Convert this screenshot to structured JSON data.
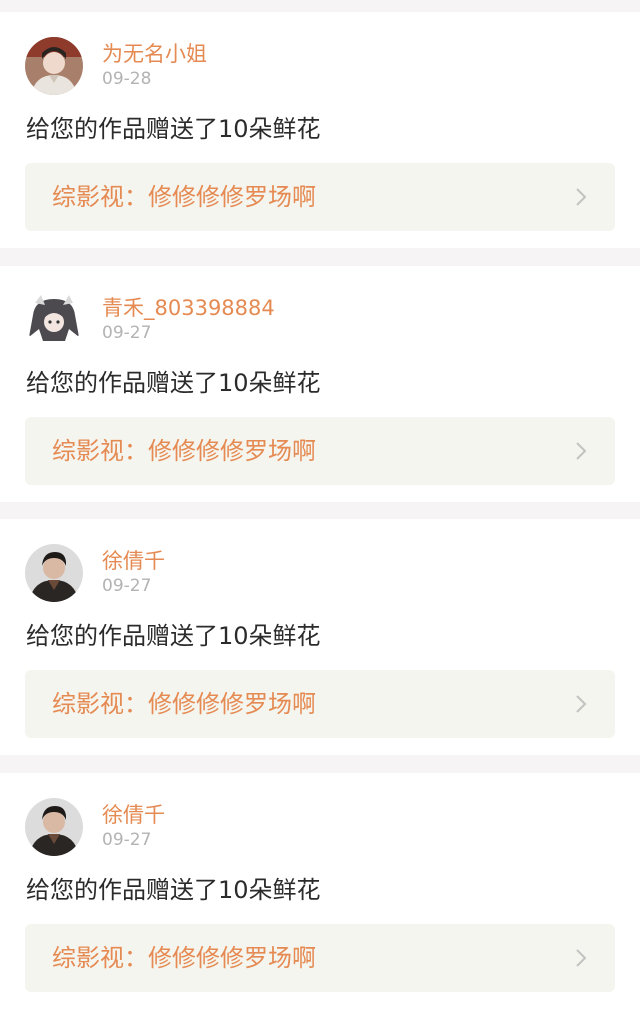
{
  "notifications": [
    {
      "username": "为无名小姐",
      "date": "09-28",
      "message": "给您的作品赠送了10朵鲜花",
      "work_label": "综影视：修修修修罗场啊",
      "avatar_icon": "man-costume-portrait-avatar"
    },
    {
      "username": "青禾_803398884",
      "date": "09-27",
      "message": "给您的作品赠送了10朵鲜花",
      "work_label": "综影视：修修修修罗场啊",
      "avatar_icon": "anime-girl-avatar"
    },
    {
      "username": "徐倩千",
      "date": "09-27",
      "message": "给您的作品赠送了10朵鲜花",
      "work_label": "综影视：修修修修罗场啊",
      "avatar_icon": "man-portrait-avatar"
    },
    {
      "username": "徐倩千",
      "date": "09-27",
      "message": "给您的作品赠送了10朵鲜花",
      "work_label": "综影视：修修修修罗场啊",
      "avatar_icon": "man-portrait-avatar"
    }
  ],
  "colors": {
    "accent": "#e58a52",
    "date": "#b3b3b3",
    "text": "#2b2b2b",
    "card": "#ffffff",
    "link_bg": "#f5f5ef",
    "page_bg": "#f6f4f4"
  }
}
